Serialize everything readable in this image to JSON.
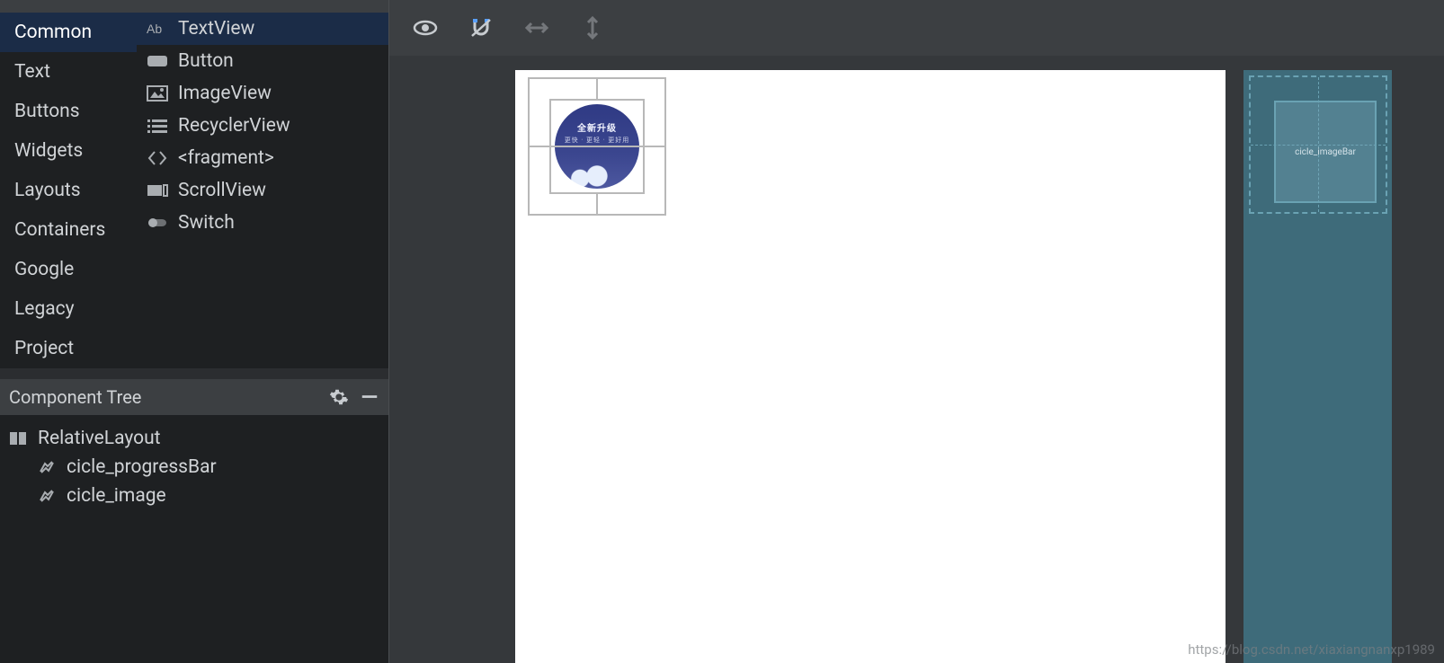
{
  "palette": {
    "categories": [
      "Common",
      "Text",
      "Buttons",
      "Widgets",
      "Layouts",
      "Containers",
      "Google",
      "Legacy",
      "Project"
    ],
    "selected_category": "Common",
    "widgets": [
      {
        "icon": "text-ab",
        "label": "TextView",
        "selected": true
      },
      {
        "icon": "button",
        "label": "Button"
      },
      {
        "icon": "image",
        "label": "ImageView"
      },
      {
        "icon": "list",
        "label": "RecyclerView"
      },
      {
        "icon": "angles",
        "label": "<fragment>"
      },
      {
        "icon": "scroll",
        "label": "ScrollView"
      },
      {
        "icon": "switch",
        "label": "Switch"
      }
    ]
  },
  "component_tree": {
    "title": "Component Tree",
    "root": {
      "label": "RelativeLayout"
    },
    "children": [
      {
        "label": "cicle_progressBar"
      },
      {
        "label": "cicle_image"
      }
    ]
  },
  "toolbar": {
    "eye": "visibility",
    "magnet": "magnet",
    "harrow": "horizontal-resize",
    "varrow": "vertical-resize"
  },
  "preview": {
    "image_title": "全新升级",
    "image_sub": "更快 · 更轻 · 更好用",
    "blueprint_label": "cicle_imageBar"
  },
  "watermark": "https://blog.csdn.net/xiaxiangnanxp1989"
}
